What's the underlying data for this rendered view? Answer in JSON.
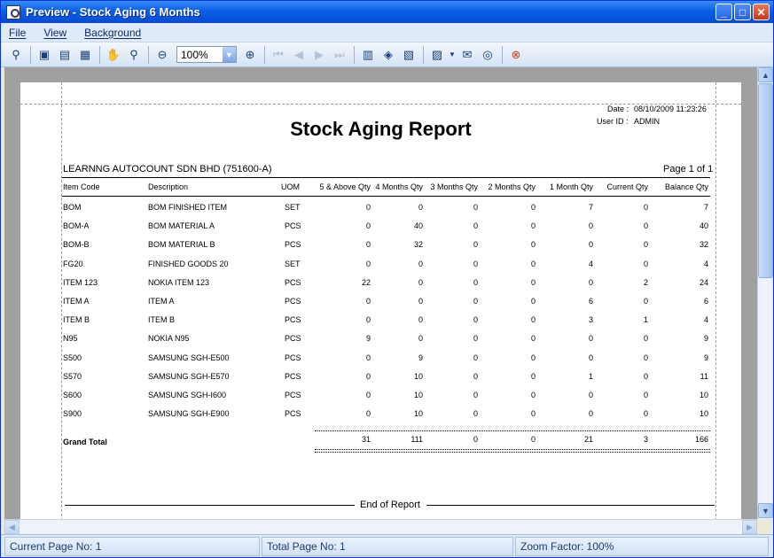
{
  "window": {
    "title": "Preview - Stock Aging 6 Months",
    "minimize": "_",
    "maximize": "□",
    "close": "✕"
  },
  "menu": [
    "File",
    "View",
    "Background"
  ],
  "toolbar": {
    "zoom_value": "100%",
    "zoom_arrow": "▼",
    "icons": {
      "find": "binoculars-icon",
      "print_setup": "printer-setup-icon",
      "print": "printer-icon",
      "page_setup": "page-setup-icon",
      "hand": "hand-icon",
      "magnifier": "magnifier-icon",
      "zoom_out": "zoom-out-icon",
      "zoom_in": "zoom-in-icon",
      "first": "first-page-icon",
      "prev": "prev-page-icon",
      "next": "next-page-icon",
      "last": "last-page-icon",
      "multi_page": "multiple-pages-icon",
      "bg_color": "background-color-icon",
      "watermark": "watermark-icon",
      "export": "export-icon",
      "send_email": "email-icon",
      "open": "open-icon",
      "exit": "close-preview-icon"
    }
  },
  "report": {
    "date_label": "Date :",
    "date_value": "08/10/2009 11:23:26",
    "user_label": "User ID :",
    "user_value": "ADMIN",
    "title": "Stock Aging Report",
    "company": "LEARNNG AUTOCOUNT SDN BHD (751600-A)",
    "page_info": "Page 1 of 1",
    "columns": [
      "Item Code",
      "Description",
      "UOM",
      "5 & Above Qty",
      "4 Months Qty",
      "3 Months Qty",
      "2 Months Qty",
      "1 Month Qty",
      "Current Qty",
      "Balance Qty"
    ],
    "rows": [
      [
        "BOM",
        "BOM FINISHED ITEM",
        "SET",
        "0",
        "0",
        "0",
        "0",
        "7",
        "0",
        "7"
      ],
      [
        "BOM-A",
        "BOM MATERIAL A",
        "PCS",
        "0",
        "40",
        "0",
        "0",
        "0",
        "0",
        "40"
      ],
      [
        "BOM-B",
        "BOM MATERIAL B",
        "PCS",
        "0",
        "32",
        "0",
        "0",
        "0",
        "0",
        "32"
      ],
      [
        "FG20",
        "FINISHED GOODS 20",
        "SET",
        "0",
        "0",
        "0",
        "0",
        "4",
        "0",
        "4"
      ],
      [
        "ITEM 123",
        "NOKIA ITEM 123",
        "PCS",
        "22",
        "0",
        "0",
        "0",
        "0",
        "2",
        "24"
      ],
      [
        "ITEM A",
        "ITEM A",
        "PCS",
        "0",
        "0",
        "0",
        "0",
        "6",
        "0",
        "6"
      ],
      [
        "ITEM B",
        "ITEM B",
        "PCS",
        "0",
        "0",
        "0",
        "0",
        "3",
        "1",
        "4"
      ],
      [
        "N95",
        "NOKIA N95",
        "PCS",
        "9",
        "0",
        "0",
        "0",
        "0",
        "0",
        "9"
      ],
      [
        "S500",
        "SAMSUNG SGH-E500",
        "PCS",
        "0",
        "9",
        "0",
        "0",
        "0",
        "0",
        "9"
      ],
      [
        "S570",
        "SAMSUNG SGH-E570",
        "PCS",
        "0",
        "10",
        "0",
        "0",
        "1",
        "0",
        "11"
      ],
      [
        "S600",
        "SAMSUNG SGH-I600",
        "PCS",
        "0",
        "10",
        "0",
        "0",
        "0",
        "0",
        "10"
      ],
      [
        "S900",
        "SAMSUNG SGH-E900",
        "PCS",
        "0",
        "10",
        "0",
        "0",
        "0",
        "0",
        "10"
      ]
    ],
    "grand_total_label": "Grand Total",
    "grand_total": [
      "31",
      "111",
      "0",
      "0",
      "21",
      "3",
      "166"
    ],
    "end_of_report": "End of Report"
  },
  "status": {
    "current_page": "Current Page No: 1",
    "total_page": "Total Page No: 1",
    "zoom_factor": "Zoom Factor: 100%"
  },
  "scroll": {
    "up": "▲",
    "down": "▼",
    "left": "◀",
    "right": "▶"
  }
}
